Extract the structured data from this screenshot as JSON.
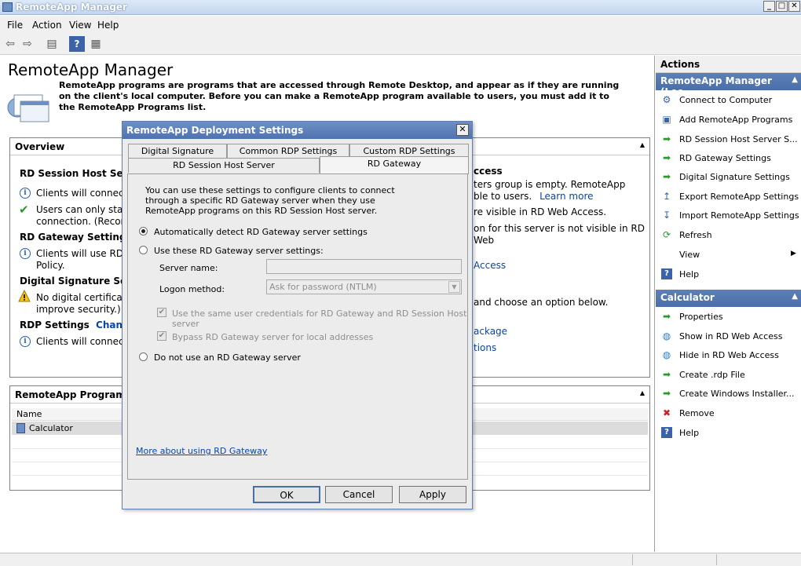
{
  "window": {
    "title": "RemoteApp Manager",
    "controls": [
      "_",
      "□",
      "✕"
    ]
  },
  "menu": [
    "File",
    "Action",
    "View",
    "Help"
  ],
  "main": {
    "title": "RemoteApp Manager",
    "intro": "RemoteApp programs are programs that are accessed through Remote Desktop, and appear as if they are running on the client's local computer. Before you can make a RemoteApp program available to users, you must add it to the RemoteApp Programs list.",
    "overview": {
      "header": "Overview",
      "rdsh_title": "RD Session Host Server",
      "rdsh_line1": "Clients will connect t",
      "rdsh_line2a": "Users can only start l",
      "rdsh_line2b": "connection. (Recom",
      "gw_title": "RD Gateway Settings",
      "gw_link": "C",
      "gw_line1a": "Clients will use RD G",
      "gw_line1b": "Policy.",
      "sig_title": "Digital Signature Settin",
      "sig_line1a": "No digital certificate",
      "sig_line1b": "improve security.)",
      "rdp_title": "RDP Settings",
      "rdp_link": "Change",
      "rdp_line1": "Clients will connect v",
      "right_access": "ccess",
      "right_line1": "ters group is empty. RemoteApp",
      "right_line2": "ble to users.",
      "right_learn": "Learn more",
      "right_line3": "re visible in RD Web Access.",
      "right_line4": "on for this server is not visible in RD Web",
      "right_link_access": "Access",
      "right_line5": "and choose an option below.",
      "right_link_pkg": "ackage",
      "right_link_opt": "tions"
    },
    "programs": {
      "header": "RemoteApp Programs",
      "col_name": "Name",
      "rows": [
        "Calculator"
      ]
    }
  },
  "actions": {
    "title": "Actions",
    "group1": "RemoteApp Manager (Loc...",
    "items1": [
      "Connect to Computer",
      "Add RemoteApp Programs",
      "RD Session Host Server S...",
      "RD Gateway Settings",
      "Digital Signature Settings",
      "Export RemoteApp Settings",
      "Import RemoteApp Settings",
      "Refresh",
      "View",
      "Help"
    ],
    "group2": "Calculator",
    "items2": [
      "Properties",
      "Show in RD Web Access",
      "Hide in RD Web Access",
      "Create .rdp File",
      "Create Windows Installer...",
      "Remove",
      "Help"
    ]
  },
  "dialog": {
    "title": "RemoteApp Deployment Settings",
    "tabs_row1": [
      "Digital Signature",
      "Common RDP Settings",
      "Custom RDP Settings"
    ],
    "tabs_row2": [
      "RD Session Host Server",
      "RD Gateway"
    ],
    "description": "You can use these settings to configure clients to connect through a specific RD Gateway server when they use RemoteApp programs on this RD Session Host server.",
    "opt_auto": "Automatically detect RD Gateway server settings",
    "opt_use": "Use these RD Gateway server settings:",
    "server_name_label": "Server name:",
    "logon_label": "Logon method:",
    "logon_value": "Ask for password (NTLM)",
    "chk_same_creds": "Use the same user credentials for RD Gateway and RD Session Host server",
    "chk_bypass": "Bypass RD Gateway server for local addresses",
    "opt_none": "Do not use an RD Gateway server",
    "more_link": "More about using RD Gateway",
    "ok": "OK",
    "cancel": "Cancel",
    "apply": "Apply"
  }
}
